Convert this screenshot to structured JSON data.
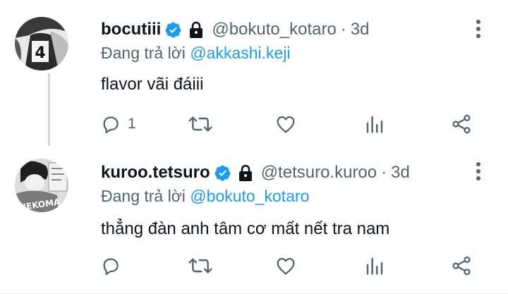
{
  "tweets": [
    {
      "display_name": "bocutiii",
      "handle": "@bokuto_kotaro",
      "separator": "·",
      "time": "3d",
      "reply_prefix": "Đang trả lời",
      "reply_to": "@akkashi.keji",
      "text": "flavor vãi đáiii",
      "reply_count": "1",
      "verified": true,
      "protected": true,
      "avatar_number": "4"
    },
    {
      "display_name": "kuroo.tetsuro",
      "handle": "@tetsuro.kuroo",
      "separator": "·",
      "time": "3d",
      "reply_prefix": "Đang trả lời",
      "reply_to": "@bokuto_kotaro",
      "text": "thẳng đàn anh tâm cơ mất nết tra nam",
      "reply_count": "",
      "verified": true,
      "protected": true,
      "avatar_jersey_text": "NEKOMA"
    }
  ],
  "icons": {
    "verified": "verified-badge-icon",
    "protected": "lock-icon",
    "more": "more-vertical-icon",
    "reply": "reply-icon",
    "retweet": "retweet-icon",
    "like": "heart-icon",
    "views": "analytics-icon",
    "share": "share-icon"
  },
  "colors": {
    "accent": "#1d9bf0",
    "secondary_text": "#536471",
    "primary_text": "#0f1419",
    "thread_line": "#cfd9de"
  }
}
